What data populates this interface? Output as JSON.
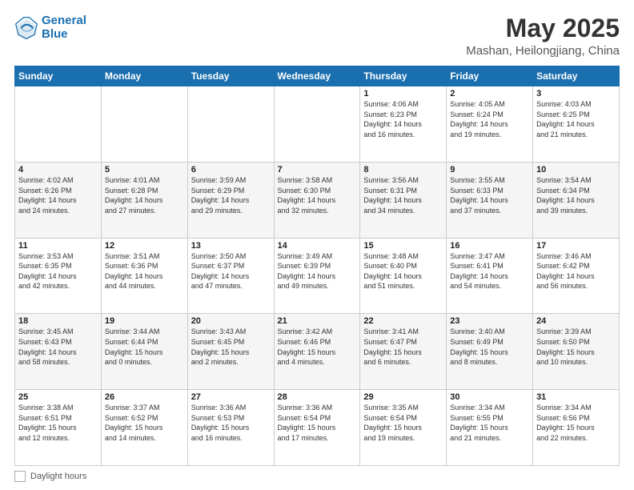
{
  "logo": {
    "line1": "General",
    "line2": "Blue"
  },
  "title": "May 2025",
  "subtitle": "Mashan, Heilongjiang, China",
  "days_of_week": [
    "Sunday",
    "Monday",
    "Tuesday",
    "Wednesday",
    "Thursday",
    "Friday",
    "Saturday"
  ],
  "weeks": [
    [
      {
        "day": "",
        "info": ""
      },
      {
        "day": "",
        "info": ""
      },
      {
        "day": "",
        "info": ""
      },
      {
        "day": "",
        "info": ""
      },
      {
        "day": "1",
        "info": "Sunrise: 4:06 AM\nSunset: 6:23 PM\nDaylight: 14 hours\nand 16 minutes."
      },
      {
        "day": "2",
        "info": "Sunrise: 4:05 AM\nSunset: 6:24 PM\nDaylight: 14 hours\nand 19 minutes."
      },
      {
        "day": "3",
        "info": "Sunrise: 4:03 AM\nSunset: 6:25 PM\nDaylight: 14 hours\nand 21 minutes."
      }
    ],
    [
      {
        "day": "4",
        "info": "Sunrise: 4:02 AM\nSunset: 6:26 PM\nDaylight: 14 hours\nand 24 minutes."
      },
      {
        "day": "5",
        "info": "Sunrise: 4:01 AM\nSunset: 6:28 PM\nDaylight: 14 hours\nand 27 minutes."
      },
      {
        "day": "6",
        "info": "Sunrise: 3:59 AM\nSunset: 6:29 PM\nDaylight: 14 hours\nand 29 minutes."
      },
      {
        "day": "7",
        "info": "Sunrise: 3:58 AM\nSunset: 6:30 PM\nDaylight: 14 hours\nand 32 minutes."
      },
      {
        "day": "8",
        "info": "Sunrise: 3:56 AM\nSunset: 6:31 PM\nDaylight: 14 hours\nand 34 minutes."
      },
      {
        "day": "9",
        "info": "Sunrise: 3:55 AM\nSunset: 6:33 PM\nDaylight: 14 hours\nand 37 minutes."
      },
      {
        "day": "10",
        "info": "Sunrise: 3:54 AM\nSunset: 6:34 PM\nDaylight: 14 hours\nand 39 minutes."
      }
    ],
    [
      {
        "day": "11",
        "info": "Sunrise: 3:53 AM\nSunset: 6:35 PM\nDaylight: 14 hours\nand 42 minutes."
      },
      {
        "day": "12",
        "info": "Sunrise: 3:51 AM\nSunset: 6:36 PM\nDaylight: 14 hours\nand 44 minutes."
      },
      {
        "day": "13",
        "info": "Sunrise: 3:50 AM\nSunset: 6:37 PM\nDaylight: 14 hours\nand 47 minutes."
      },
      {
        "day": "14",
        "info": "Sunrise: 3:49 AM\nSunset: 6:39 PM\nDaylight: 14 hours\nand 49 minutes."
      },
      {
        "day": "15",
        "info": "Sunrise: 3:48 AM\nSunset: 6:40 PM\nDaylight: 14 hours\nand 51 minutes."
      },
      {
        "day": "16",
        "info": "Sunrise: 3:47 AM\nSunset: 6:41 PM\nDaylight: 14 hours\nand 54 minutes."
      },
      {
        "day": "17",
        "info": "Sunrise: 3:46 AM\nSunset: 6:42 PM\nDaylight: 14 hours\nand 56 minutes."
      }
    ],
    [
      {
        "day": "18",
        "info": "Sunrise: 3:45 AM\nSunset: 6:43 PM\nDaylight: 14 hours\nand 58 minutes."
      },
      {
        "day": "19",
        "info": "Sunrise: 3:44 AM\nSunset: 6:44 PM\nDaylight: 15 hours\nand 0 minutes."
      },
      {
        "day": "20",
        "info": "Sunrise: 3:43 AM\nSunset: 6:45 PM\nDaylight: 15 hours\nand 2 minutes."
      },
      {
        "day": "21",
        "info": "Sunrise: 3:42 AM\nSunset: 6:46 PM\nDaylight: 15 hours\nand 4 minutes."
      },
      {
        "day": "22",
        "info": "Sunrise: 3:41 AM\nSunset: 6:47 PM\nDaylight: 15 hours\nand 6 minutes."
      },
      {
        "day": "23",
        "info": "Sunrise: 3:40 AM\nSunset: 6:49 PM\nDaylight: 15 hours\nand 8 minutes."
      },
      {
        "day": "24",
        "info": "Sunrise: 3:39 AM\nSunset: 6:50 PM\nDaylight: 15 hours\nand 10 minutes."
      }
    ],
    [
      {
        "day": "25",
        "info": "Sunrise: 3:38 AM\nSunset: 6:51 PM\nDaylight: 15 hours\nand 12 minutes."
      },
      {
        "day": "26",
        "info": "Sunrise: 3:37 AM\nSunset: 6:52 PM\nDaylight: 15 hours\nand 14 minutes."
      },
      {
        "day": "27",
        "info": "Sunrise: 3:36 AM\nSunset: 6:53 PM\nDaylight: 15 hours\nand 16 minutes."
      },
      {
        "day": "28",
        "info": "Sunrise: 3:36 AM\nSunset: 6:54 PM\nDaylight: 15 hours\nand 17 minutes."
      },
      {
        "day": "29",
        "info": "Sunrise: 3:35 AM\nSunset: 6:54 PM\nDaylight: 15 hours\nand 19 minutes."
      },
      {
        "day": "30",
        "info": "Sunrise: 3:34 AM\nSunset: 6:55 PM\nDaylight: 15 hours\nand 21 minutes."
      },
      {
        "day": "31",
        "info": "Sunrise: 3:34 AM\nSunset: 6:56 PM\nDaylight: 15 hours\nand 22 minutes."
      }
    ]
  ],
  "footer": {
    "daylight_label": "Daylight hours"
  },
  "colors": {
    "header_bg": "#1a6faf",
    "header_text": "#ffffff",
    "border": "#cccccc",
    "row_even": "#f5f5f5",
    "row_odd": "#ffffff"
  }
}
